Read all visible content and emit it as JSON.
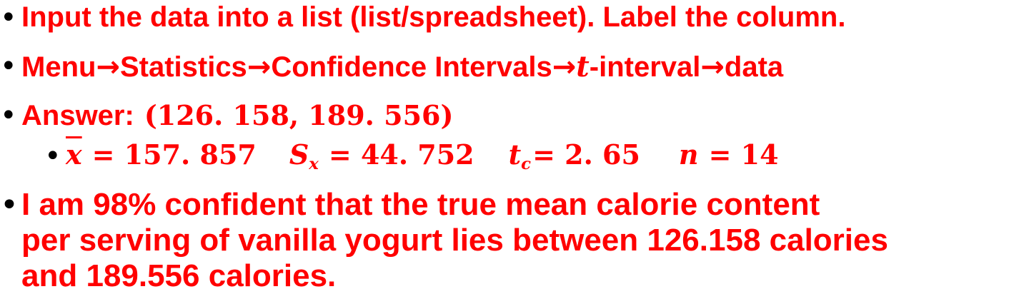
{
  "bullets": {
    "l1": "Input the data into a list (list/spreadsheet). Label the column.",
    "l2": {
      "menu": "Menu",
      "arrow": "→",
      "stats": "Statistics",
      "ci": "Confidence Intervals",
      "t": "t",
      "tint": "-interval",
      "data": "data"
    },
    "l3": {
      "label": "Answer:",
      "interval": "(126. 158, 189. 556)"
    },
    "l4": {
      "xbar": "x",
      "xbar_val": "= 157. 857",
      "sx_s": "S",
      "sx_sub": "x",
      "sx_val": "= 44. 752",
      "tc_t": "t",
      "tc_sub": "c",
      "tc_val": "= 2. 65",
      "n": "n",
      "n_val": "= 14"
    },
    "l5": {
      "line1": "I am 98% confident that the true mean calorie content",
      "line2": "per serving of vanilla yogurt lies between 126.158 calories",
      "line3": "and 189.556 calories."
    },
    "bullet_char": "•"
  },
  "colors": {
    "text": "#ff0000",
    "bullet": "#000000"
  }
}
